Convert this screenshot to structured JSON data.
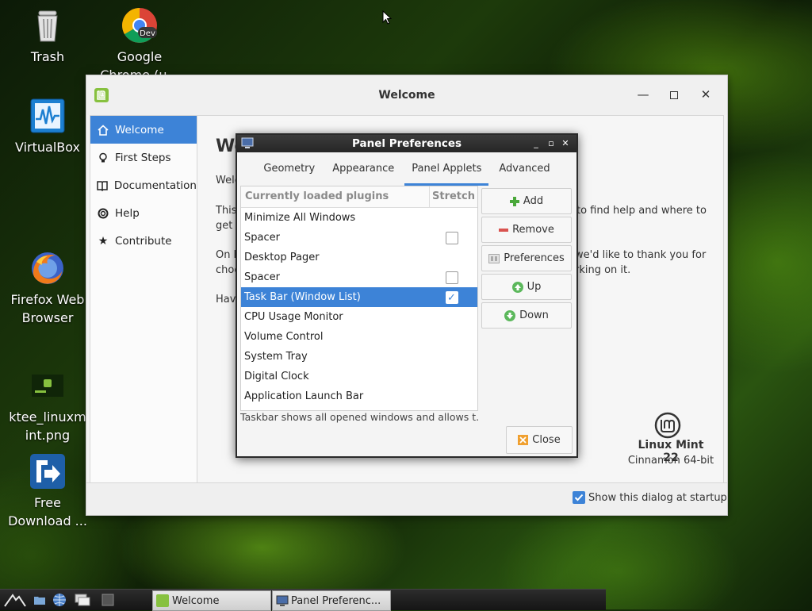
{
  "desktop": {
    "icons": [
      {
        "label": "Trash",
        "icon": "trash-icon"
      },
      {
        "label": "Google Chrome (u...",
        "icon": "chrome-dev-icon"
      },
      {
        "label": "VirtualBox",
        "icon": "virtualbox-icon"
      },
      {
        "label": "Firefox Web Browser",
        "icon": "firefox-icon"
      },
      {
        "label": "ktee_linuxmint.png",
        "icon": "image-file-icon"
      },
      {
        "label": "Free Download ...",
        "icon": "free-download-manager-icon"
      }
    ]
  },
  "welcome": {
    "title": "Welcome",
    "sidebar": [
      {
        "label": "Welcome",
        "icon": "home-icon",
        "active": true
      },
      {
        "label": "First Steps",
        "icon": "lightbulb-icon"
      },
      {
        "label": "Documentation",
        "icon": "book-icon"
      },
      {
        "label": "Help",
        "icon": "lifebuoy-icon"
      },
      {
        "label": "Contribute",
        "icon": "star-icon"
      }
    ],
    "heading": "We",
    "para0": "Welc",
    "para1_left": "This",
    "para1_left2": "get",
    "para1_right": "to find help and where to",
    "para2_left": "On b",
    "para2_left2": "choo",
    "para2_right": "we'd like to thank you for",
    "para2_right2": "rking on it.",
    "para3_left": "Hav",
    "brand_name": "Linux Mint 22",
    "brand_sub": "Cinnamon 64-bit",
    "show_at_startup": "Show this dialog at startup",
    "show_at_startup_checked": true
  },
  "panel_prefs": {
    "title": "Panel Preferences",
    "tabs": [
      {
        "label": "Geometry"
      },
      {
        "label": "Appearance"
      },
      {
        "label": "Panel Applets",
        "active": true
      },
      {
        "label": "Advanced"
      }
    ],
    "list": {
      "col_plugins": "Currently loaded plugins",
      "col_stretch": "Stretch",
      "rows": [
        {
          "name": "Minimize All Windows",
          "checkbox": false
        },
        {
          "name": "Spacer",
          "checkbox": true,
          "checked": false
        },
        {
          "name": "Desktop Pager",
          "checkbox": false
        },
        {
          "name": "Spacer",
          "checkbox": true,
          "checked": false
        },
        {
          "name": "Task Bar (Window List)",
          "checkbox": true,
          "checked": true,
          "selected": true
        },
        {
          "name": "CPU Usage Monitor",
          "checkbox": false
        },
        {
          "name": "Volume Control",
          "checkbox": false
        },
        {
          "name": "System Tray",
          "checkbox": false
        },
        {
          "name": "Digital Clock",
          "checkbox": false
        },
        {
          "name": "Application Launch Bar",
          "checkbox": false
        }
      ]
    },
    "status": "Taskbar shows all opened windows and allows t...",
    "buttons": {
      "add": "Add",
      "remove": "Remove",
      "preferences": "Preferences",
      "up": "Up",
      "down": "Down",
      "close": "Close"
    }
  },
  "taskbar": {
    "items": [
      {
        "label": "Welcome",
        "icon": "mint-icon"
      },
      {
        "label": "Panel Preferenc...",
        "icon": "monitor-icon"
      }
    ]
  },
  "colors": {
    "accent": "#3d83d7",
    "mint_green": "#87c13f",
    "add_green": "#4aa83a",
    "remove_red": "#d9534f"
  }
}
